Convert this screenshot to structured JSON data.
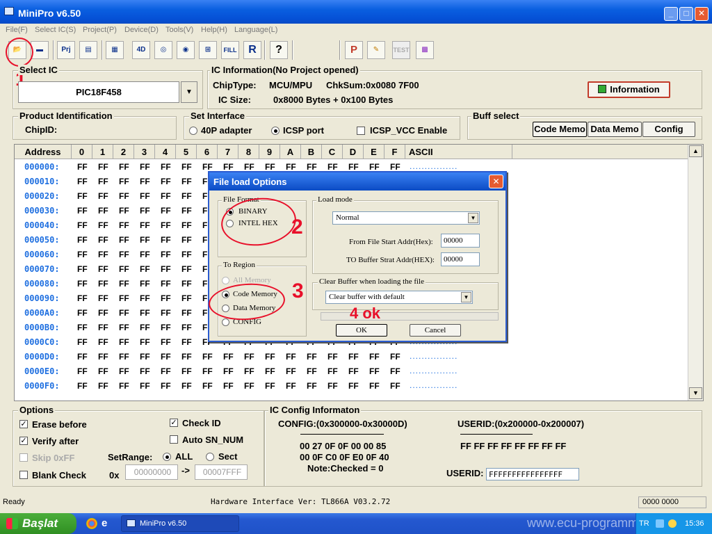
{
  "window": {
    "title": "MiniPro v6.50"
  },
  "menu": [
    "File(F)",
    "Select IC(S)",
    "Project(P)",
    "Device(D)",
    "Tools(V)",
    "Help(H)",
    "Language(L)"
  ],
  "toolbar": {
    "prj": "Prj",
    "d4": "4D",
    "fill": "FILL",
    "r": "R",
    "help": "?",
    "p": "P",
    "test": "TEST"
  },
  "select_ic": {
    "title": "Select IC",
    "value": "PIC18F458"
  },
  "ic_info": {
    "title": "IC Information(No Project opened)",
    "chiptype_label": "ChipType:",
    "chiptype": "MCU/MPU",
    "chksum_label": "ChkSum:",
    "chksum": "0x0080 7F00",
    "icsize_label": "IC Size:",
    "icsize": "0x8000 Bytes + 0x100 Bytes",
    "info_button": "Information"
  },
  "product_id": {
    "title": "Product Identification",
    "chipid_label": "ChipID:"
  },
  "interface": {
    "title": "Set Interface",
    "opt1": "40P adapter",
    "opt2": "ICSP port",
    "opt3": "ICSP_VCC Enable"
  },
  "buff": {
    "title": "Buff select",
    "code": "Code Memo",
    "data": "Data Memo",
    "config": "Config"
  },
  "grid": {
    "headers": [
      "Address",
      "0",
      "1",
      "2",
      "3",
      "4",
      "5",
      "6",
      "7",
      "8",
      "9",
      "A",
      "B",
      "C",
      "D",
      "E",
      "F",
      "ASCII"
    ],
    "addresses": [
      "000000:",
      "000010:",
      "000020:",
      "000030:",
      "000040:",
      "000050:",
      "000060:",
      "000070:",
      "000080:",
      "000090:",
      "0000A0:",
      "0000B0:",
      "0000C0:",
      "0000D0:",
      "0000E0:",
      "0000F0:"
    ],
    "cell": "FF",
    "ascii": "................"
  },
  "dialog": {
    "title": "File load Options",
    "file_format": "File Format",
    "binary": "BINARY",
    "intelhex": "INTEL HEX",
    "load_mode": "Load mode",
    "mode_value": "Normal",
    "from_label": "From File Start Addr(Hex):",
    "from_value": "00000",
    "to_label": "TO Buffer Strat Addr(HEX):",
    "to_value": "00000",
    "region": "To Region",
    "all": "All Memory",
    "code": "Code Memory",
    "data": "Data Memory",
    "config": "CONFIG",
    "clear": "Clear Buffer when loading the file",
    "clear_value": "Clear buffer with default",
    "ok": "OK",
    "cancel": "Cancel"
  },
  "annotations": {
    "a1": "1",
    "a2": "2",
    "a3": "3",
    "a4": "4 ok"
  },
  "options": {
    "title": "Options",
    "erase": "Erase before",
    "verify": "Verify after",
    "skip": "Skip 0xFF",
    "blank": "Blank Check",
    "checkid": "Check ID",
    "autosn": "Auto SN_NUM",
    "setrange": "SetRange:",
    "all": "ALL",
    "sect": "Sect",
    "ox": "0x",
    "from": "00000000",
    "arrow": "->",
    "to": "00007FFF"
  },
  "icconfig": {
    "title": "IC Config Informaton",
    "config_label": "CONFIG:(0x300000-0x30000D)",
    "userid_label": "USERID:(0x200000-0x200007)",
    "config_line1": "00 27 0F 0F 00 00 85",
    "config_line2": "00 0F C0 0F E0 0F 40",
    "note": "Note:Checked = 0",
    "userid_bytes": "FF FF FF FF FF FF FF FF",
    "userid_field_label": "USERID:",
    "userid_field": "FFFFFFFFFFFFFFFF"
  },
  "status": {
    "ready": "Ready",
    "hw": "Hardware Interface Ver: TL866A V03.2.72",
    "right": "0000 0000"
  },
  "taskbar": {
    "start": "Başlat",
    "task": "MiniPro v6.50",
    "watermark": "www.ecu-programmer",
    "lang": "TR",
    "time": "15:36"
  }
}
